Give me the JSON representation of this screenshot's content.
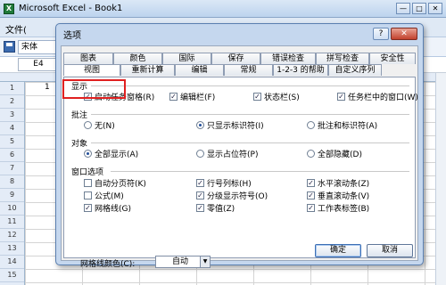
{
  "excel": {
    "title": "Microsoft Excel - Book1",
    "app_icon_glyph": "X",
    "win_min": "—",
    "win_max": "□",
    "win_close": "✕",
    "menu_file": "文件(",
    "font_name": "宋体",
    "name_box": "E4",
    "row_numbers": [
      "1",
      "2",
      "3",
      "4",
      "5",
      "6",
      "7",
      "8",
      "9",
      "10",
      "11",
      "12",
      "13",
      "14",
      "15"
    ],
    "cell_a1_value": "1"
  },
  "dialog": {
    "title": "选项",
    "help_glyph": "?",
    "close_glyph": "✕",
    "tabs_row1": [
      {
        "label": "图表",
        "w": 56
      },
      {
        "label": "颜色",
        "w": 55
      },
      {
        "label": "国际",
        "w": 55
      },
      {
        "label": "保存",
        "w": 55
      },
      {
        "label": "错误检查",
        "w": 62
      },
      {
        "label": "拼写检查",
        "w": 60
      },
      {
        "label": "安全性",
        "w": 52
      }
    ],
    "tabs_row2": [
      {
        "label": "视图",
        "w": 64,
        "active": true
      },
      {
        "label": "重新计算",
        "w": 61
      },
      {
        "label": "编辑",
        "w": 55
      },
      {
        "label": "常规",
        "w": 55
      },
      {
        "label": "1-2-3 的帮助",
        "w": 62
      },
      {
        "label": "自定义序列",
        "w": 60
      }
    ],
    "sections": {
      "display": "显示",
      "comments": "批注",
      "objects": "对象",
      "window_options": "窗口选项"
    },
    "display_options": [
      {
        "label": "启动任务窗格(R)",
        "checked": true
      },
      {
        "label": "编辑栏(F)",
        "checked": true
      },
      {
        "label": "状态栏(S)",
        "checked": true
      },
      {
        "label": "任务栏中的窗口(W)",
        "checked": true
      }
    ],
    "comment_options": [
      {
        "label": "无(N)",
        "selected": false
      },
      {
        "label": "只显示标识符(I)",
        "selected": true
      },
      {
        "label": "批注和标识符(A)",
        "selected": false
      }
    ],
    "object_options": [
      {
        "label": "全部显示(A)",
        "selected": true
      },
      {
        "label": "显示占位符(P)",
        "selected": false
      },
      {
        "label": "全部隐藏(D)",
        "selected": false
      }
    ],
    "window_options": [
      {
        "label": "自动分页符(K)",
        "checked": false
      },
      {
        "label": "行号列标(H)",
        "checked": true
      },
      {
        "label": "水平滚动条(Z)",
        "checked": true
      },
      {
        "label": "公式(M)",
        "checked": false
      },
      {
        "label": "分级显示符号(O)",
        "checked": true
      },
      {
        "label": "垂直滚动条(V)",
        "checked": true
      },
      {
        "label": "网格线(G)",
        "checked": true
      },
      {
        "label": "零值(Z)",
        "checked": true
      },
      {
        "label": "工作表标签(B)",
        "checked": true
      }
    ],
    "gridline_color_label": "网格线颜色(C):",
    "gridline_color_value": "自动",
    "dropdown_arrow": "▼",
    "ok_label": "确定",
    "cancel_label": "取消",
    "checkmark": "✓"
  }
}
